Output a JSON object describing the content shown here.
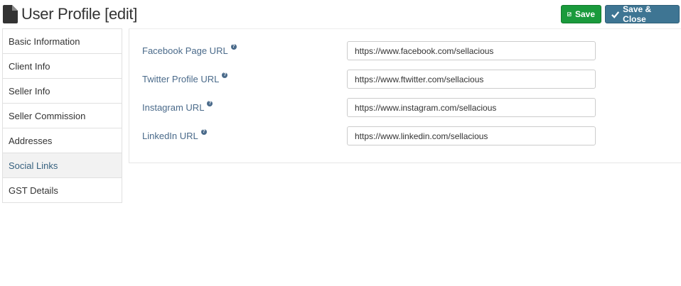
{
  "header": {
    "title": "User Profile [edit]",
    "save_label": "Save",
    "save_close_label": "Save & Close"
  },
  "sidebar": {
    "items": [
      {
        "label": "Basic Information",
        "active": false
      },
      {
        "label": "Client Info",
        "active": false
      },
      {
        "label": "Seller Info",
        "active": false
      },
      {
        "label": "Seller Commission",
        "active": false
      },
      {
        "label": "Addresses",
        "active": false
      },
      {
        "label": "Social Links",
        "active": true
      },
      {
        "label": "GST Details",
        "active": false
      }
    ]
  },
  "form": {
    "fields": [
      {
        "label": "Facebook Page URL",
        "value": "https://www.facebook.com/sellacious"
      },
      {
        "label": "Twitter Profile URL",
        "value": "https://www.ftwitter.com/sellacious"
      },
      {
        "label": "Instagram URL",
        "value": "https://www.instagram.com/sellacious"
      },
      {
        "label": "LinkedIn URL",
        "value": "https://www.linkedin.com/sellacious"
      }
    ]
  },
  "icons": {
    "title_icon": "file-icon",
    "save_icon": "edit-check-icon",
    "save_close_icon": "check-icon",
    "help_icon": "question-icon"
  },
  "colors": {
    "save": "#1a9a3c",
    "save_close": "#3e7593",
    "label": "#4a6a8a",
    "active_item": "#35607e"
  }
}
